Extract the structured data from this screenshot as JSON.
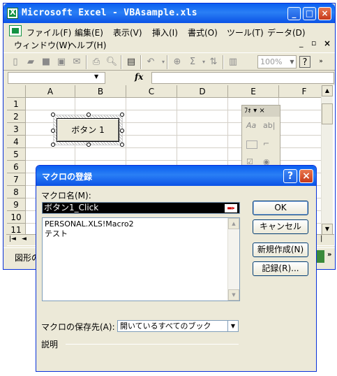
{
  "excel": {
    "title": "Microsoft Excel - VBAsample.xls",
    "title_buttons": {
      "minimize": "_",
      "maximize": "□",
      "close": "×"
    },
    "menu": [
      "ファイル(F)",
      "編集(E)",
      "表示(V)",
      "挿入(I)",
      "書式(O)",
      "ツール(T)",
      "データ(D)",
      "ウィンドウ(W)",
      "ヘルプ(H)"
    ],
    "toolbar": {
      "zoom": "100%"
    },
    "formula_bar": {
      "fx": "fx"
    },
    "columns": [
      "A",
      "B",
      "C",
      "D",
      "E",
      "F"
    ],
    "rows": [
      "1",
      "2",
      "3",
      "4",
      "5",
      "6",
      "7",
      "8",
      "9",
      "10",
      "11"
    ],
    "sheet_button_label": "ボタン 1",
    "forms_toolbar_title": "ﾌｫ ▾ ×",
    "drawing_label": "図形の"
  },
  "dialog": {
    "title": "マクロの登録",
    "help": "?",
    "close": "×",
    "macro_name_label": "マクロ名(M):",
    "macro_name_value": "ボタン1_Click",
    "macro_list": [
      "PERSONAL.XLS!Macro2",
      "テスト"
    ],
    "buttons": {
      "ok": "OK",
      "cancel": "キャンセル",
      "new": "新規作成(N)",
      "record": "記録(R)..."
    },
    "save_in_label": "マクロの保存先(A):",
    "save_in_value": "開いているすべてのブック",
    "description_label": "説明"
  }
}
